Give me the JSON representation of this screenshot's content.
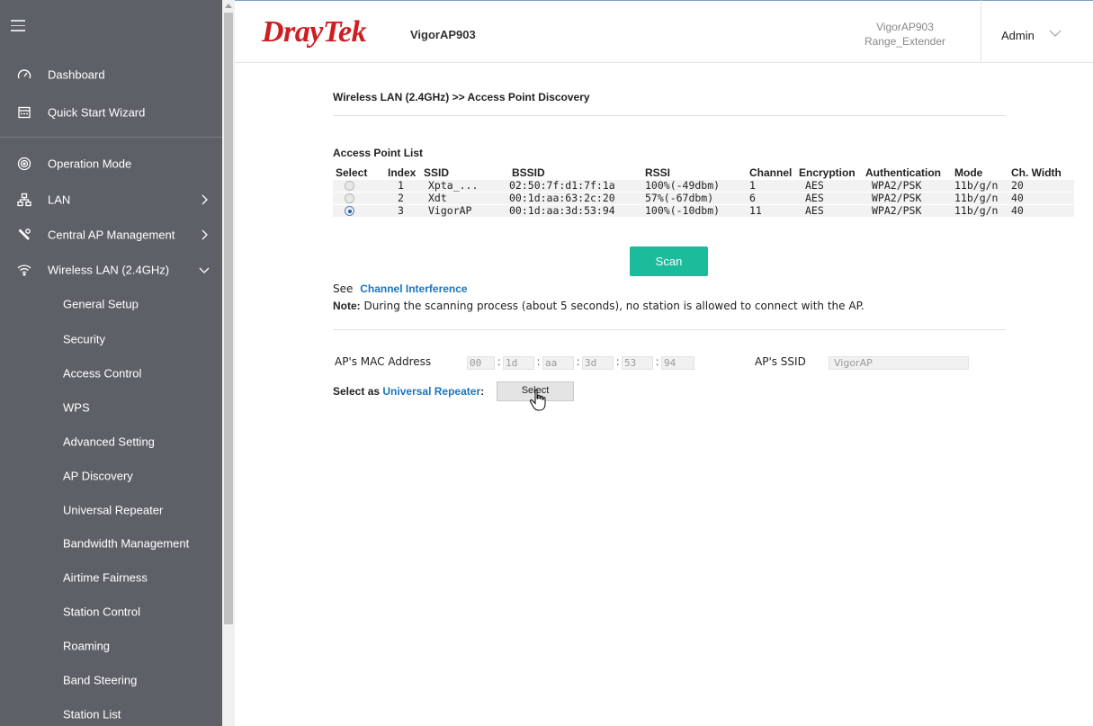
{
  "sidebar": {
    "items": [
      {
        "id": "dashboard",
        "label": "Dashboard",
        "icon": "gauge-icon"
      },
      {
        "id": "quick-start",
        "label": "Quick Start Wizard",
        "icon": "wizard-icon"
      },
      {
        "id": "operation-mode",
        "label": "Operation Mode",
        "icon": "mode-icon"
      },
      {
        "id": "lan",
        "label": "LAN",
        "icon": "network-icon",
        "chevron": "right"
      },
      {
        "id": "central-ap",
        "label": "Central AP Management",
        "icon": "wrench-icon",
        "chevron": "right"
      },
      {
        "id": "wireless-lan",
        "label": "Wireless LAN (2.4GHz)",
        "icon": "wifi-icon",
        "chevron": "down"
      }
    ],
    "sub_items": [
      "General Setup",
      "Security",
      "Access Control",
      "WPS",
      "Advanced Setting",
      "AP Discovery",
      "Universal Repeater",
      "Bandwidth Management",
      "Airtime Fairness",
      "Station Control",
      "Roaming",
      "Band Steering",
      "Station List"
    ]
  },
  "header": {
    "logo_dray": "Dray",
    "logo_tek": "Tek",
    "model": "VigorAP903",
    "device_name_line1": "VigorAP903",
    "device_name_line2": "Range_Extender",
    "user": "Admin"
  },
  "main": {
    "breadcrumb": "Wireless LAN (2.4GHz) >> Access Point Discovery",
    "section_title": "Access Point List",
    "table": {
      "headers": [
        "Select",
        "Index",
        "SSID",
        "BSSID",
        "RSSI",
        "Channel",
        "Encryption",
        "Authentication",
        "Mode",
        "Ch. Width"
      ],
      "rows": [
        {
          "selected": false,
          "index": "1",
          "ssid": "Xpta_...",
          "bssid": "02:50:7f:d1:7f:1a",
          "rssi": "100%(-49dbm)",
          "channel": "1",
          "encryption": "AES",
          "authentication": "WPA2/PSK",
          "mode": "11b/g/n",
          "width": "20"
        },
        {
          "selected": false,
          "index": "2",
          "ssid": "Xdt",
          "bssid": "00:1d:aa:63:2c:20",
          "rssi": "57%(-67dbm)",
          "channel": "6",
          "encryption": "AES",
          "authentication": "WPA2/PSK",
          "mode": "11b/g/n",
          "width": "40"
        },
        {
          "selected": true,
          "index": "3",
          "ssid": "VigorAP",
          "bssid": "00:1d:aa:3d:53:94",
          "rssi": "100%(-10dbm)",
          "channel": "11",
          "encryption": "AES",
          "authentication": "WPA2/PSK",
          "mode": "11b/g/n",
          "width": "40"
        }
      ]
    },
    "scan_label": "Scan",
    "see_prefix": "See",
    "channel_interference_link": "Channel Interference",
    "note_label": "Note:",
    "note_text": "During the scanning process (about 5 seconds), no station is allowed to connect with the AP.",
    "mac_label": "AP's MAC Address",
    "mac": [
      "00",
      "1d",
      "aa",
      "3d",
      "53",
      "94"
    ],
    "mac_sep": ":",
    "ssid_label": "AP's SSID",
    "ssid_value": "VigorAP",
    "repeater_prefix": "Select as",
    "repeater_link": "Universal Repeater",
    "repeater_colon": ":",
    "select_label": "Select"
  },
  "colors": {
    "sidebar_bg": "#5d6167",
    "brand_red": "#cf1d22",
    "scan_green": "#1bbc9b",
    "link_blue": "#1a76c1"
  }
}
